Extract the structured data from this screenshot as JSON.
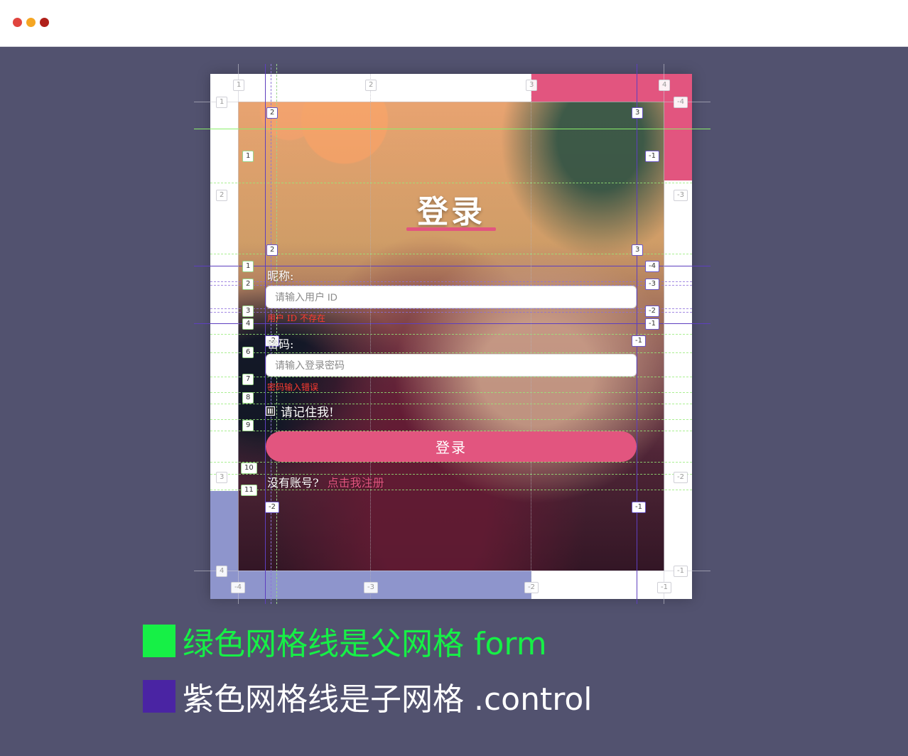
{
  "window": {
    "controls": [
      "close",
      "minimize",
      "zoom"
    ]
  },
  "form": {
    "title": "登录",
    "nickname": {
      "label": "昵称:",
      "placeholder": "请输入用户 ID",
      "error": "用户 ID 不存在"
    },
    "password": {
      "label": "密码:",
      "placeholder": "请输入登录密码",
      "error": "密码输入错误"
    },
    "remember": {
      "label": "请记住我!",
      "checked": true
    },
    "submit_label": "登录",
    "signup": {
      "prompt": "没有账号?",
      "link": "点击我注册"
    }
  },
  "grid_badges": {
    "outer_top": [
      "1",
      "2",
      "3",
      "4"
    ],
    "outer_right": [
      "-4",
      "-3",
      "-2",
      "-1"
    ],
    "outer_left": [
      "1",
      "2",
      "3",
      "4"
    ],
    "outer_bottom": [
      "-4",
      "-3",
      "-2",
      "-1"
    ],
    "form_left": [
      "1",
      "2",
      "3",
      "4",
      "6",
      "7",
      "8",
      "9",
      "10",
      "11"
    ],
    "form_right": [
      "-1",
      "-4",
      "-3",
      "-2",
      "-1"
    ],
    "control_top": [
      "2",
      "3",
      "2",
      "3"
    ],
    "control_bottom": [
      "-2",
      "-1",
      "-2",
      "-1"
    ]
  },
  "legend": {
    "green": "绿色网格线是父网格 form",
    "purple": "紫色网格线是子网格 .control"
  },
  "colors": {
    "accent": "#e2557f",
    "background": "#52526f",
    "parent_grid": "#16f046",
    "child_grid": "#4a24a3",
    "error": "#ff3b30"
  }
}
